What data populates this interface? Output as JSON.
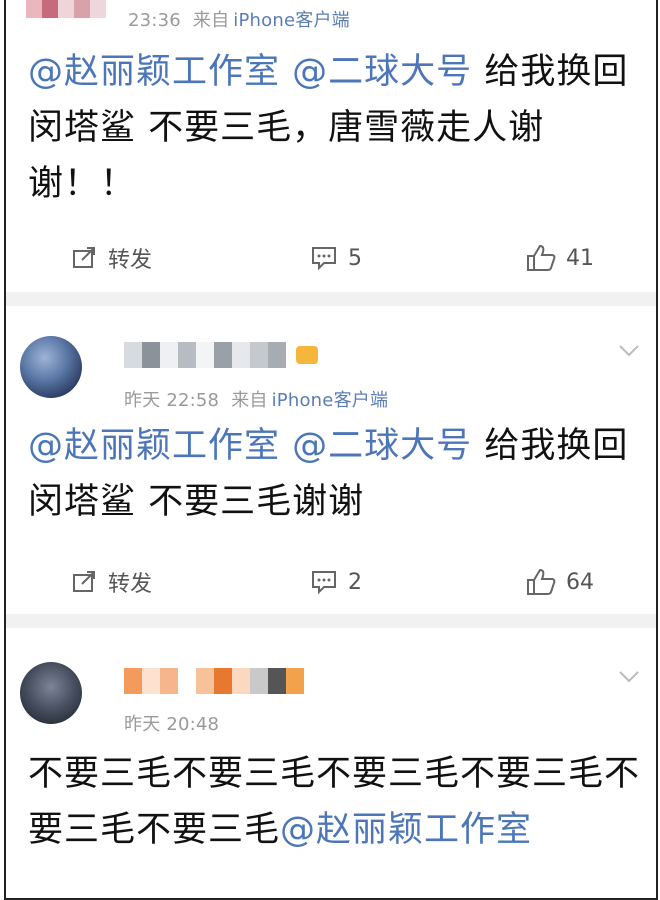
{
  "posts": [
    {
      "meta_time": "23:36",
      "meta_source_label": "来自",
      "meta_source_app": "iPhone客户端",
      "mention_1": "@赵丽颖工作室",
      "mention_2": "@二球大号",
      "text_after_mentions": "给我换回闵塔鲨 不要三毛，唐雪薇走人谢谢！！",
      "repost_label": "转发",
      "comment_count": "5",
      "like_count": "41"
    },
    {
      "meta_time": "昨天 22:58",
      "meta_source_label": "来自",
      "meta_source_app": "iPhone客户端",
      "mention_1": "@赵丽颖工作室",
      "mention_2": "@二球大号",
      "text_after_mentions": "给我换回闵塔鲨 不要三毛谢谢",
      "repost_label": "转发",
      "comment_count": "2",
      "like_count": "64"
    },
    {
      "meta_time": "昨天 20:48",
      "text_before_mention": "不要三毛不要三毛不要三毛不要三毛不要三毛不要三毛",
      "mention_1": "@赵丽颖工作室"
    }
  ],
  "colors": {
    "mention": "#4c76b8",
    "meta": "#9a9a9a",
    "divider": "#f1f1f1"
  },
  "icons": [
    "repost-icon",
    "comment-icon",
    "like-icon",
    "chevron-down-icon",
    "avatar",
    "vip-badge-icon"
  ]
}
